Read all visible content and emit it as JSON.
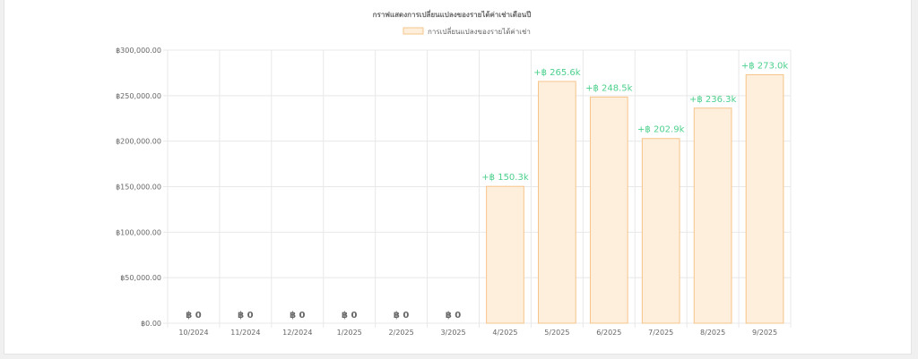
{
  "chart_data": {
    "type": "bar",
    "title": "กราฟแสดงการเปลี่ยนแปลงของรายได้ค่าเช่าเดือนปี",
    "legend": [
      "การเปลี่ยนแปลงของรายได้ค่าเช่า"
    ],
    "legend_position": "top-center",
    "categories": [
      "10/2024",
      "11/2024",
      "12/2024",
      "1/2025",
      "2/2025",
      "3/2025",
      "4/2025",
      "5/2025",
      "6/2025",
      "7/2025",
      "8/2025",
      "9/2025"
    ],
    "series": [
      {
        "name": "การเปลี่ยนแปลงของรายได้ค่าเช่า",
        "values": [
          0,
          0,
          0,
          0,
          0,
          0,
          150300,
          265600,
          248500,
          202900,
          236300,
          273000
        ]
      }
    ],
    "data_labels": [
      "฿ 0",
      "฿ 0",
      "฿ 0",
      "฿ 0",
      "฿ 0",
      "฿ 0",
      "+฿ 150.3k",
      "+฿ 265.6k",
      "+฿ 248.5k",
      "+฿ 202.9k",
      "+฿ 236.3k",
      "+฿ 273.0k"
    ],
    "ylim": [
      0,
      300000
    ],
    "yticks": [
      0,
      50000,
      100000,
      150000,
      200000,
      250000,
      300000
    ],
    "ytick_labels": [
      "฿0.00",
      "฿50,000.00",
      "฿100,000.00",
      "฿150,000.00",
      "฿200,000.00",
      "฿250,000.00",
      "฿300,000.00"
    ],
    "grid": true,
    "colors": {
      "bar_fill": "#fdefdc",
      "bar_stroke": "#f6c48a",
      "positive_label": "#4cd08c",
      "zero_label": "#666666",
      "grid": "#e8e8e8"
    }
  }
}
